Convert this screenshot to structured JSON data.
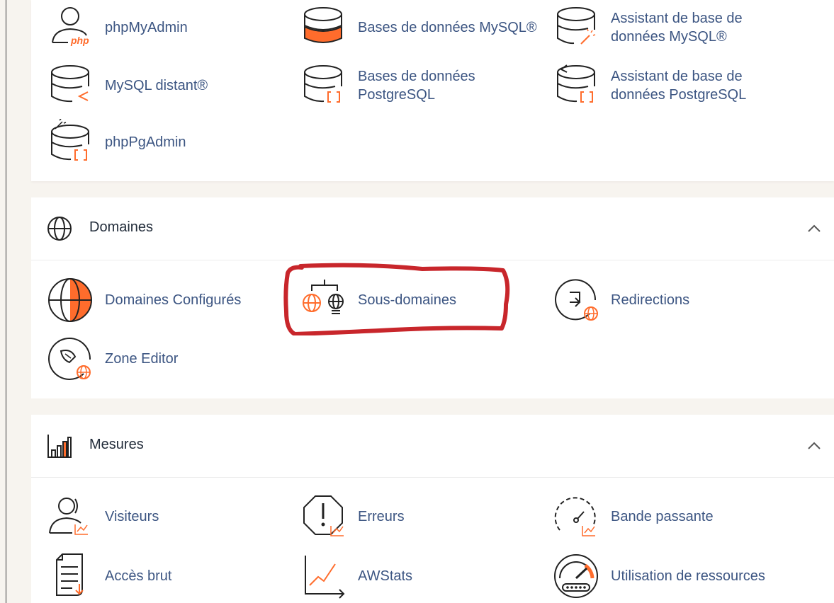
{
  "colors": {
    "accent": "#ff6c2c",
    "link": "#3c5582",
    "annotation": "#c8262b"
  },
  "databases": {
    "items": [
      {
        "label": "phpMyAdmin",
        "icon": "phpmyadmin-icon"
      },
      {
        "label": "Bases de données MySQL®",
        "icon": "mysql-databases-icon"
      },
      {
        "label": "Assistant de base de données MySQL®",
        "icon": "mysql-wizard-icon"
      },
      {
        "label": "MySQL distant®",
        "icon": "remote-mysql-icon"
      },
      {
        "label": "Bases de données PostgreSQL",
        "icon": "postgresql-databases-icon"
      },
      {
        "label": "Assistant de base de données PostgreSQL",
        "icon": "postgresql-wizard-icon"
      },
      {
        "label": "phpPgAdmin",
        "icon": "phppgadmin-icon"
      }
    ]
  },
  "domains": {
    "title": "Domaines",
    "icon": "globe-icon",
    "items": [
      {
        "label": "Domaines Configurés",
        "icon": "domains-globe-icon"
      },
      {
        "label": "Sous-domaines",
        "icon": "subdomains-icon"
      },
      {
        "label": "Redirections",
        "icon": "redirects-icon"
      },
      {
        "label": "Zone Editor",
        "icon": "zone-editor-icon"
      }
    ]
  },
  "metrics": {
    "title": "Mesures",
    "icon": "bar-chart-icon",
    "items": [
      {
        "label": "Visiteurs",
        "icon": "visitors-icon"
      },
      {
        "label": "Erreurs",
        "icon": "errors-icon"
      },
      {
        "label": "Bande passante",
        "icon": "bandwidth-icon"
      },
      {
        "label": "Accès brut",
        "icon": "raw-access-icon"
      },
      {
        "label": "AWStats",
        "icon": "awstats-icon"
      },
      {
        "label": "Utilisation de ressources",
        "icon": "resource-usage-icon"
      }
    ]
  }
}
